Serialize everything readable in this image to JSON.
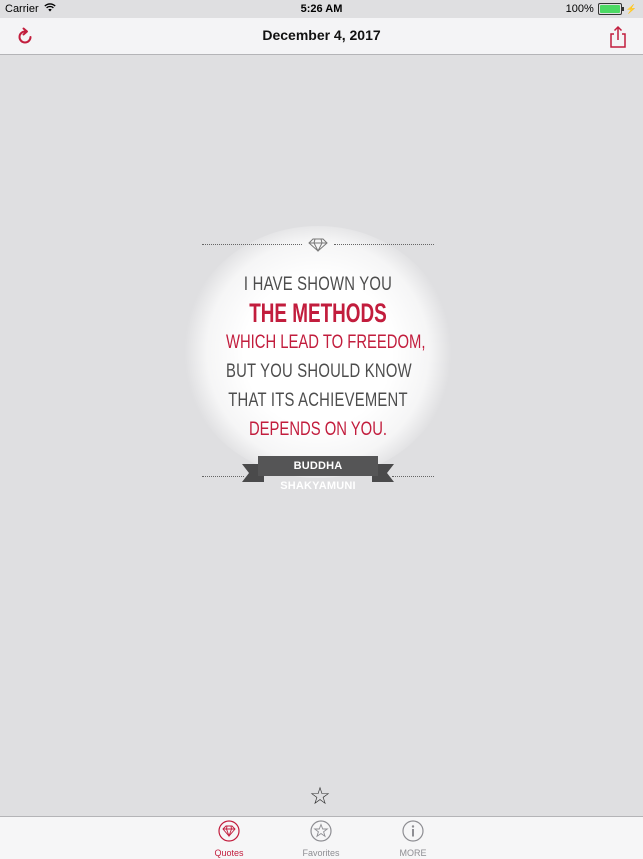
{
  "status_bar": {
    "carrier": "Carrier",
    "time": "5:26 AM",
    "battery": "100%",
    "battery_level": 1.0
  },
  "nav": {
    "title": "December 4, 2017",
    "left_icon": "refresh-icon",
    "right_icon": "share-icon",
    "accent_color": "#c21d3d"
  },
  "quote": {
    "lines": [
      "I HAVE SHOWN YOU",
      "THE METHODS",
      "WHICH LEAD TO FREEDOM,",
      "BUT YOU SHOULD KNOW",
      "THAT ITS ACHIEVEMENT",
      "DEPENDS ON YOU."
    ],
    "author": "BUDDHA SHAKYAMUNI",
    "ornament_icon": "diamond-icon"
  },
  "favorite": {
    "icon": "star-outline-icon"
  },
  "tabs": [
    {
      "label": "Quotes",
      "icon": "diamond-icon",
      "active": true
    },
    {
      "label": "Favorites",
      "icon": "star-circle-icon",
      "active": false
    },
    {
      "label": "MORE",
      "icon": "info-icon",
      "active": false
    }
  ]
}
